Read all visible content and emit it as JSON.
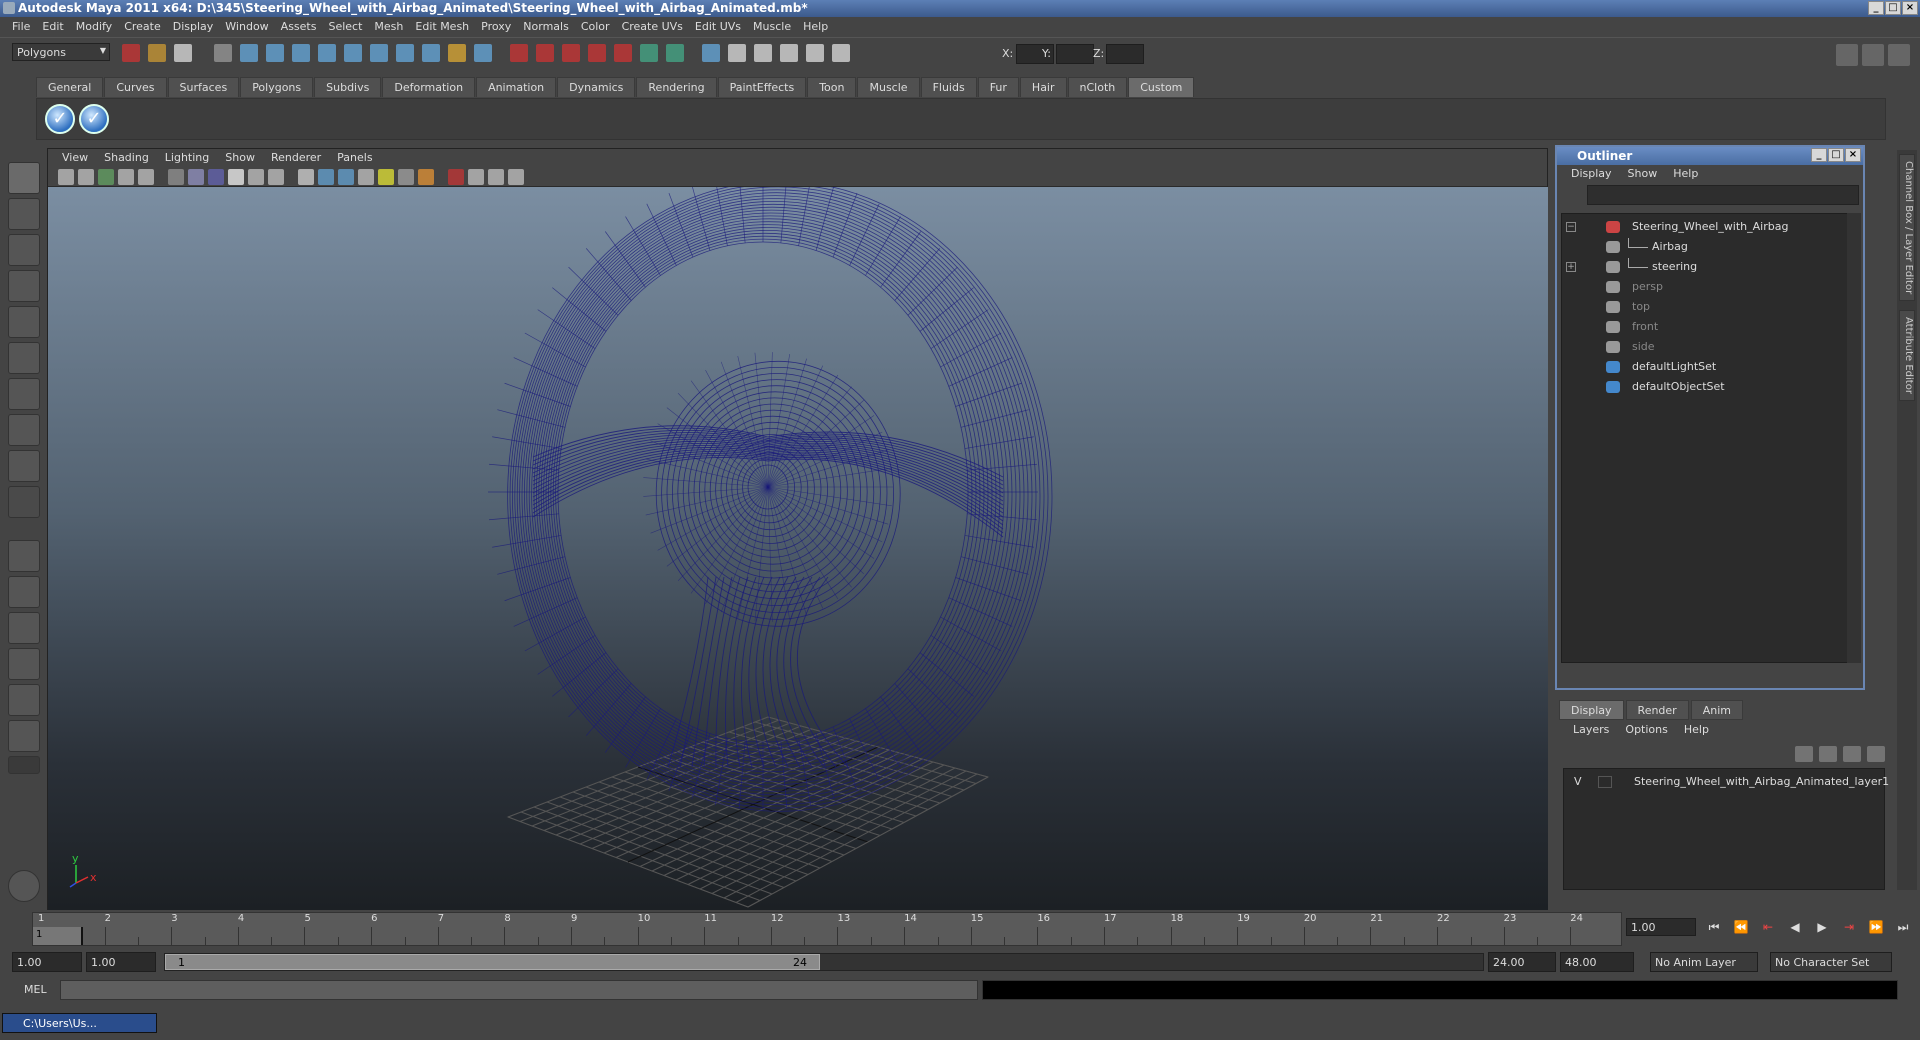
{
  "window": {
    "title": "Autodesk Maya 2011 x64: D:\\345\\Steering_Wheel_with_Airbag_Animated\\Steering_Wheel_with_Airbag_Animated.mb*"
  },
  "menubar": [
    "File",
    "Edit",
    "Modify",
    "Create",
    "Display",
    "Window",
    "Assets",
    "Select",
    "Mesh",
    "Edit Mesh",
    "Proxy",
    "Normals",
    "Color",
    "Create UVs",
    "Edit UVs",
    "Muscle",
    "Help"
  ],
  "statusline": {
    "mode": "Polygons",
    "x_label": "X:",
    "y_label": "Y:",
    "z_label": "Z:"
  },
  "shelf": {
    "tabs": [
      "General",
      "Curves",
      "Surfaces",
      "Polygons",
      "Subdivs",
      "Deformation",
      "Animation",
      "Dynamics",
      "Rendering",
      "PaintEffects",
      "Toon",
      "Muscle",
      "Fluids",
      "Fur",
      "Hair",
      "nCloth",
      "Custom"
    ],
    "active": "Custom"
  },
  "viewport": {
    "menu": [
      "View",
      "Shading",
      "Lighting",
      "Show",
      "Renderer",
      "Panels"
    ],
    "axis_x": "x",
    "axis_y": "y"
  },
  "outliner": {
    "title": "Outliner",
    "menu": [
      "Display",
      "Show",
      "Help"
    ],
    "items": [
      {
        "label": "Steering_Wheel_with_Airbag",
        "type": "transform",
        "dim": false
      },
      {
        "label": "Airbag",
        "type": "mesh",
        "dim": false
      },
      {
        "label": "steering",
        "type": "mesh",
        "dim": false
      },
      {
        "label": "persp",
        "type": "camera",
        "dim": true
      },
      {
        "label": "top",
        "type": "camera",
        "dim": true
      },
      {
        "label": "front",
        "type": "camera",
        "dim": true
      },
      {
        "label": "side",
        "type": "camera",
        "dim": true
      },
      {
        "label": "defaultLightSet",
        "type": "set",
        "dim": false
      },
      {
        "label": "defaultObjectSet",
        "type": "set",
        "dim": false
      }
    ]
  },
  "layer_editor": {
    "tabs": [
      "Display",
      "Render",
      "Anim"
    ],
    "active": "Display",
    "menu": [
      "Layers",
      "Options",
      "Help"
    ],
    "layers": [
      {
        "visible": "V",
        "name": "Steering_Wheel_with_Airbag_Animated_layer1"
      }
    ]
  },
  "side_tabs": [
    "Channel Box / Layer Editor",
    "Attribute Editor"
  ],
  "timeline": {
    "ticks": [
      "1",
      "2",
      "3",
      "4",
      "5",
      "6",
      "7",
      "8",
      "9",
      "10",
      "11",
      "12",
      "13",
      "14",
      "15",
      "16",
      "17",
      "18",
      "19",
      "20",
      "21",
      "22",
      "23",
      "24"
    ],
    "current_marker": "1",
    "current_frame": "1.00"
  },
  "range": {
    "start": "1.00",
    "playback_start": "1.00",
    "slider_start": "1",
    "slider_end": "24",
    "playback_end": "24.00",
    "end": "48.00",
    "anim_layer": "No Anim Layer",
    "character_set": "No Character Set"
  },
  "cmdline": {
    "label": "MEL"
  },
  "taskbar": {
    "window": "C:\\Users\\Us..."
  },
  "colors": {
    "wireframe": "#1a1a7a",
    "title_blue": "#3c5a8c"
  }
}
